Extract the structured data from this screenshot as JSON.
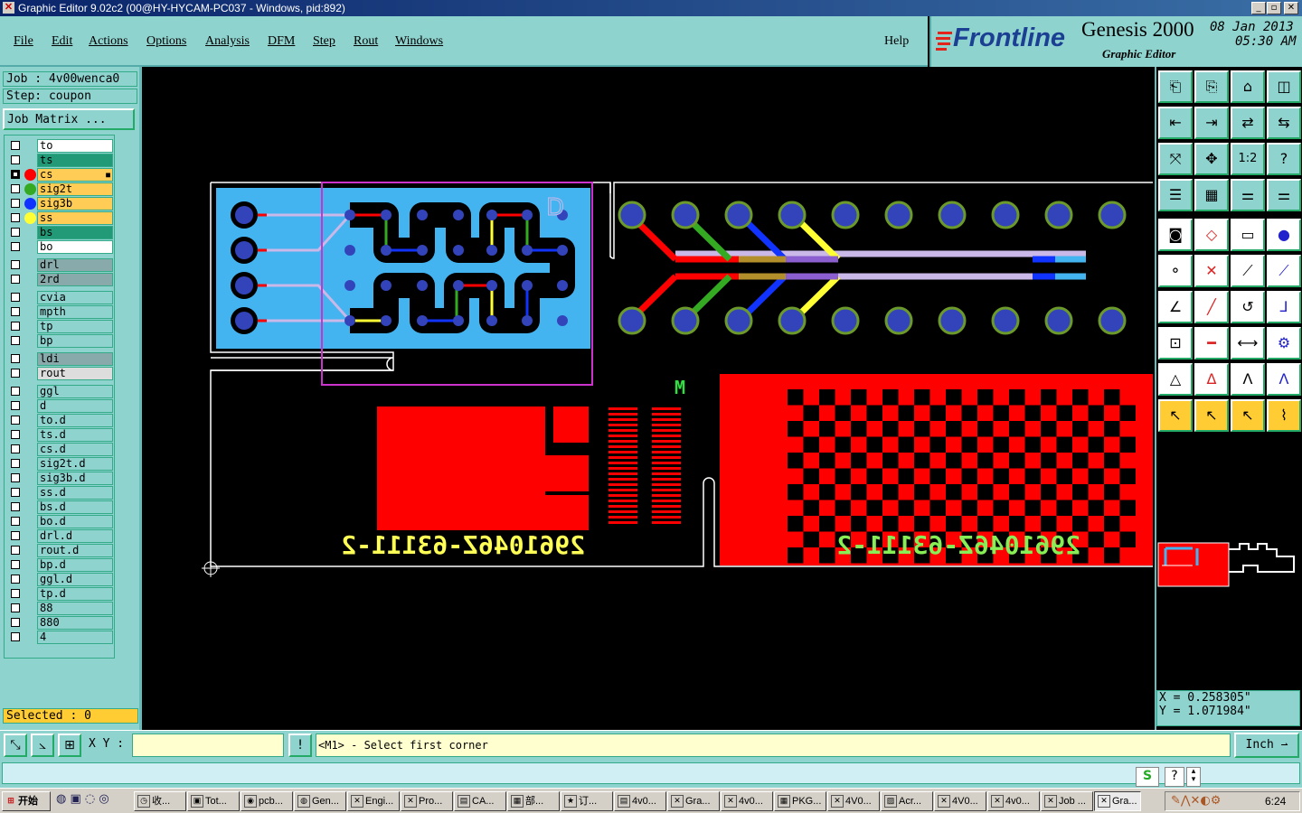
{
  "window": {
    "title": "Graphic Editor 9.02c2 (00@HY-HYCAM-PC037 - Windows, pid:892)",
    "controls": [
      "_",
      "▫",
      "✕"
    ]
  },
  "menu": {
    "items": [
      "File",
      "Edit",
      "Actions",
      "Options",
      "Analysis",
      "DFM",
      "Step",
      "Rout",
      "Windows"
    ],
    "help": "Help"
  },
  "brand": {
    "logo": "Frontline",
    "product": "Genesis 2000",
    "subtitle": "Graphic Editor",
    "date": "08 Jan 2013",
    "time": "05:30 AM"
  },
  "job": {
    "job_label": "Job : 4v00wenca0",
    "step_label": "Step: coupon",
    "matrix_button": "Job Matrix ..."
  },
  "layers": [
    {
      "name": "to",
      "color": "#ffffff",
      "dot": null,
      "checked": false
    },
    {
      "name": "ts",
      "color": "#229977",
      "dot": null,
      "checked": false
    },
    {
      "name": "cs",
      "color": "#ffcc55",
      "dot": "#ff0000",
      "checked": true,
      "marker": "■"
    },
    {
      "name": "sig2t",
      "color": "#ffcc55",
      "dot": "#33aa22",
      "checked": false
    },
    {
      "name": "sig3b",
      "color": "#ffcc55",
      "dot": "#1133ff",
      "checked": false
    },
    {
      "name": "ss",
      "color": "#ffcc55",
      "dot": "#ffff33",
      "checked": false
    },
    {
      "name": "bs",
      "color": "#229977",
      "dot": null,
      "checked": false
    },
    {
      "name": "bo",
      "color": "#ffffff",
      "dot": null,
      "checked": false
    },
    {
      "name": "drl",
      "color": "#88aaaa",
      "dot": null,
      "checked": false
    },
    {
      "name": "2rd",
      "color": "#88aaaa",
      "dot": null,
      "checked": false
    },
    {
      "name": "cvia",
      "color": "#8fd3cf",
      "dot": null,
      "checked": false
    },
    {
      "name": "mpth",
      "color": "#8fd3cf",
      "dot": null,
      "checked": false
    },
    {
      "name": "tp",
      "color": "#8fd3cf",
      "dot": null,
      "checked": false
    },
    {
      "name": "bp",
      "color": "#8fd3cf",
      "dot": null,
      "checked": false
    },
    {
      "name": "ldi",
      "color": "#88aaaa",
      "dot": null,
      "checked": false
    },
    {
      "name": "rout",
      "color": "#dddddd",
      "dot": null,
      "checked": false
    },
    {
      "name": "ggl",
      "color": "#8fd3cf",
      "dot": null,
      "checked": false
    },
    {
      "name": "d",
      "color": "#8fd3cf",
      "dot": null,
      "checked": false
    },
    {
      "name": "to.d",
      "color": "#8fd3cf",
      "dot": null,
      "checked": false
    },
    {
      "name": "ts.d",
      "color": "#8fd3cf",
      "dot": null,
      "checked": false
    },
    {
      "name": "cs.d",
      "color": "#8fd3cf",
      "dot": null,
      "checked": false
    },
    {
      "name": "sig2t.d",
      "color": "#8fd3cf",
      "dot": null,
      "checked": false
    },
    {
      "name": "sig3b.d",
      "color": "#8fd3cf",
      "dot": null,
      "checked": false
    },
    {
      "name": "ss.d",
      "color": "#8fd3cf",
      "dot": null,
      "checked": false
    },
    {
      "name": "bs.d",
      "color": "#8fd3cf",
      "dot": null,
      "checked": false
    },
    {
      "name": "bo.d",
      "color": "#8fd3cf",
      "dot": null,
      "checked": false
    },
    {
      "name": "drl.d",
      "color": "#8fd3cf",
      "dot": null,
      "checked": false
    },
    {
      "name": "rout.d",
      "color": "#8fd3cf",
      "dot": null,
      "checked": false
    },
    {
      "name": "bp.d",
      "color": "#8fd3cf",
      "dot": null,
      "checked": false
    },
    {
      "name": "ggl.d",
      "color": "#8fd3cf",
      "dot": null,
      "checked": false
    },
    {
      "name": "tp.d",
      "color": "#8fd3cf",
      "dot": null,
      "checked": false
    },
    {
      "name": "88",
      "color": "#8fd3cf",
      "dot": null,
      "checked": false
    },
    {
      "name": "880",
      "color": "#8fd3cf",
      "dot": null,
      "checked": false
    },
    {
      "name": "4",
      "color": "#8fd3cf",
      "dot": null,
      "checked": false
    }
  ],
  "selected_label": "Selected : 0",
  "canvas": {
    "text_left": "2961046Z-63111-2",
    "text_right": "2961046Z-63111-2",
    "marker_m": "M",
    "marker_d": "D"
  },
  "coordinates": {
    "x": "X = 0.258305\"",
    "y": "Y = 1.071984\""
  },
  "command": {
    "xy_label": "X Y :",
    "xy_value": "",
    "prompt": "<M1> - Select first corner",
    "unit": "Inch",
    "warn_icon": "!"
  },
  "taskbar": {
    "start": "开始",
    "tasks": [
      "收...",
      "Tot...",
      "pcb...",
      "Gen...",
      "Engi...",
      "Pro...",
      "CA...",
      "部...",
      "订...",
      "4v0...",
      "Gra...",
      "4v0...",
      "PKG...",
      "4V0...",
      "Acr...",
      "4V0...",
      "4v0...",
      "Job ...",
      "Gra..."
    ],
    "clock": "6:24"
  },
  "colors": {
    "panel": "#8fd3cf",
    "cs": "#ff0000",
    "sig2t": "#33aa22",
    "sig3b": "#1133ff",
    "ss": "#ffff33",
    "pad": "#3344bb",
    "copper_field": "#44b4f0",
    "selection_box": "#cc33cc"
  }
}
